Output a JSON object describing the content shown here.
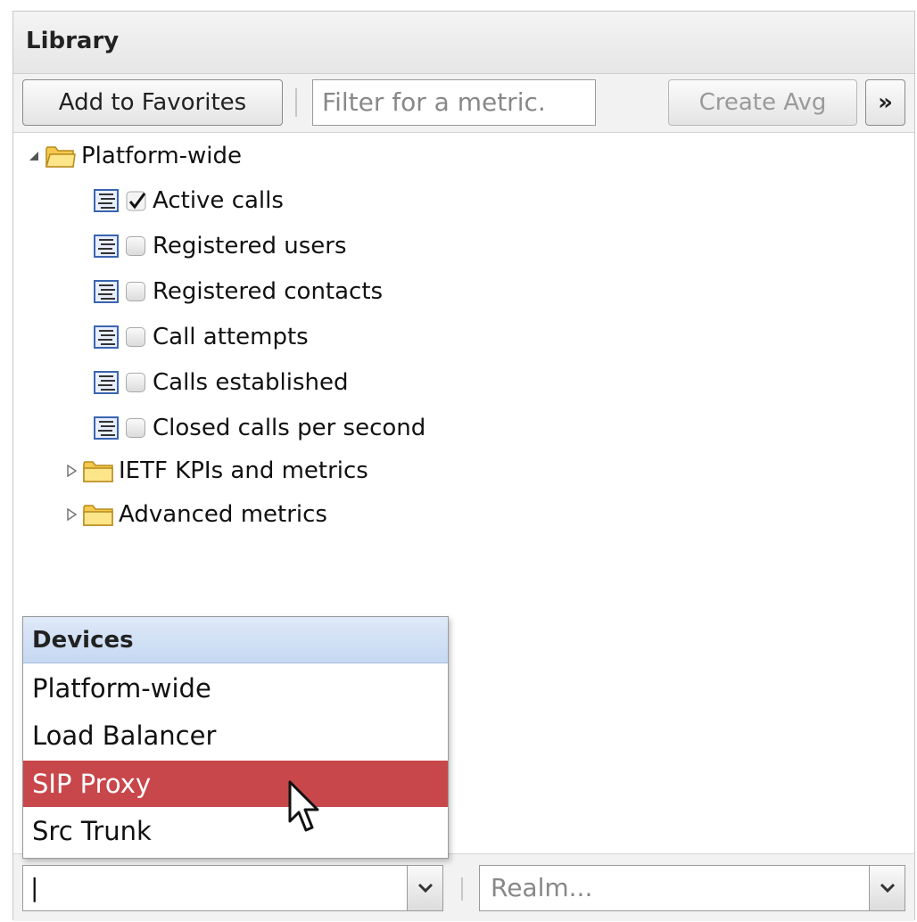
{
  "header": {
    "title": "Library"
  },
  "toolbar": {
    "add_favorites_label": "Add to Favorites",
    "filter_placeholder": "Filter for a metric.",
    "create_avg_label": "Create Avg",
    "more_label": "»"
  },
  "tree": {
    "root": {
      "label": "Platform-wide",
      "expanded": true,
      "icon": "folder-open-icon"
    },
    "items": [
      {
        "label": "Active calls",
        "checked": true
      },
      {
        "label": "Registered users",
        "checked": false
      },
      {
        "label": "Registered contacts",
        "checked": false
      },
      {
        "label": "Call attempts",
        "checked": false
      },
      {
        "label": "Calls established",
        "checked": false
      },
      {
        "label": "Closed calls per second",
        "checked": false
      }
    ],
    "folders": [
      {
        "label": "IETF KPIs and metrics",
        "expanded": false
      },
      {
        "label": "Advanced metrics",
        "expanded": false
      }
    ]
  },
  "devices_dropdown": {
    "header": "Devices",
    "options": [
      "Platform-wide",
      "Load Balancer",
      "SIP Proxy",
      "Src Trunk"
    ],
    "selected": "SIP Proxy"
  },
  "bottom": {
    "device_value": "|",
    "realm_placeholder": "Realm..."
  },
  "colors": {
    "selection": "#c8474b",
    "dropdown_header": "#c6d8f2",
    "metric_icon": "#3a65b0",
    "folder": "#f5c94e"
  }
}
